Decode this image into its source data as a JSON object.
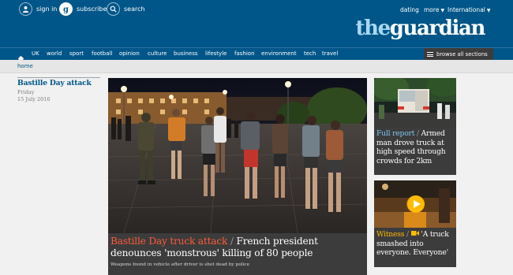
{
  "header": {
    "signin_label": "sign in",
    "subscribe_label": "subscribe",
    "search_label": "search",
    "dating_label": "dating",
    "more_label": "more",
    "edition_label": "International",
    "logo_the": "the",
    "logo_guardian": "guardian"
  },
  "nav": {
    "items": [
      "UK",
      "world",
      "sport",
      "football",
      "opinion",
      "culture",
      "business",
      "lifestyle",
      "fashion",
      "environment",
      "tech",
      "travel"
    ],
    "browse_label": "browse all sections"
  },
  "breadcrumb": {
    "home_label": "home"
  },
  "section": {
    "title": "Bastille Day attack",
    "day": "Friday",
    "date": "15 July 2016"
  },
  "main_story": {
    "kicker": "Bastille Day truck attack",
    "separator": "/",
    "headline": "French president denounces 'monstrous' killing of 80 people",
    "trail": "Weapons found in vehicle after driver is shot dead by police"
  },
  "side_stories": [
    {
      "kicker": "Full report",
      "separator": "/",
      "headline": "Armed man drove truck at high speed through crowds for 2km"
    },
    {
      "kicker": "Witness",
      "separator": "/",
      "headline": "'A truck smashed into everyone. Everyone'"
    }
  ],
  "colors": {
    "brand_blue": "#005689",
    "logo_light_blue": "#aad8f1",
    "news_kicker_red": "#ff5b3a",
    "report_kicker_blue": "#7fc6ee",
    "witness_kicker_yellow": "#ffbb00",
    "card_dark": "#3c3c3c"
  }
}
